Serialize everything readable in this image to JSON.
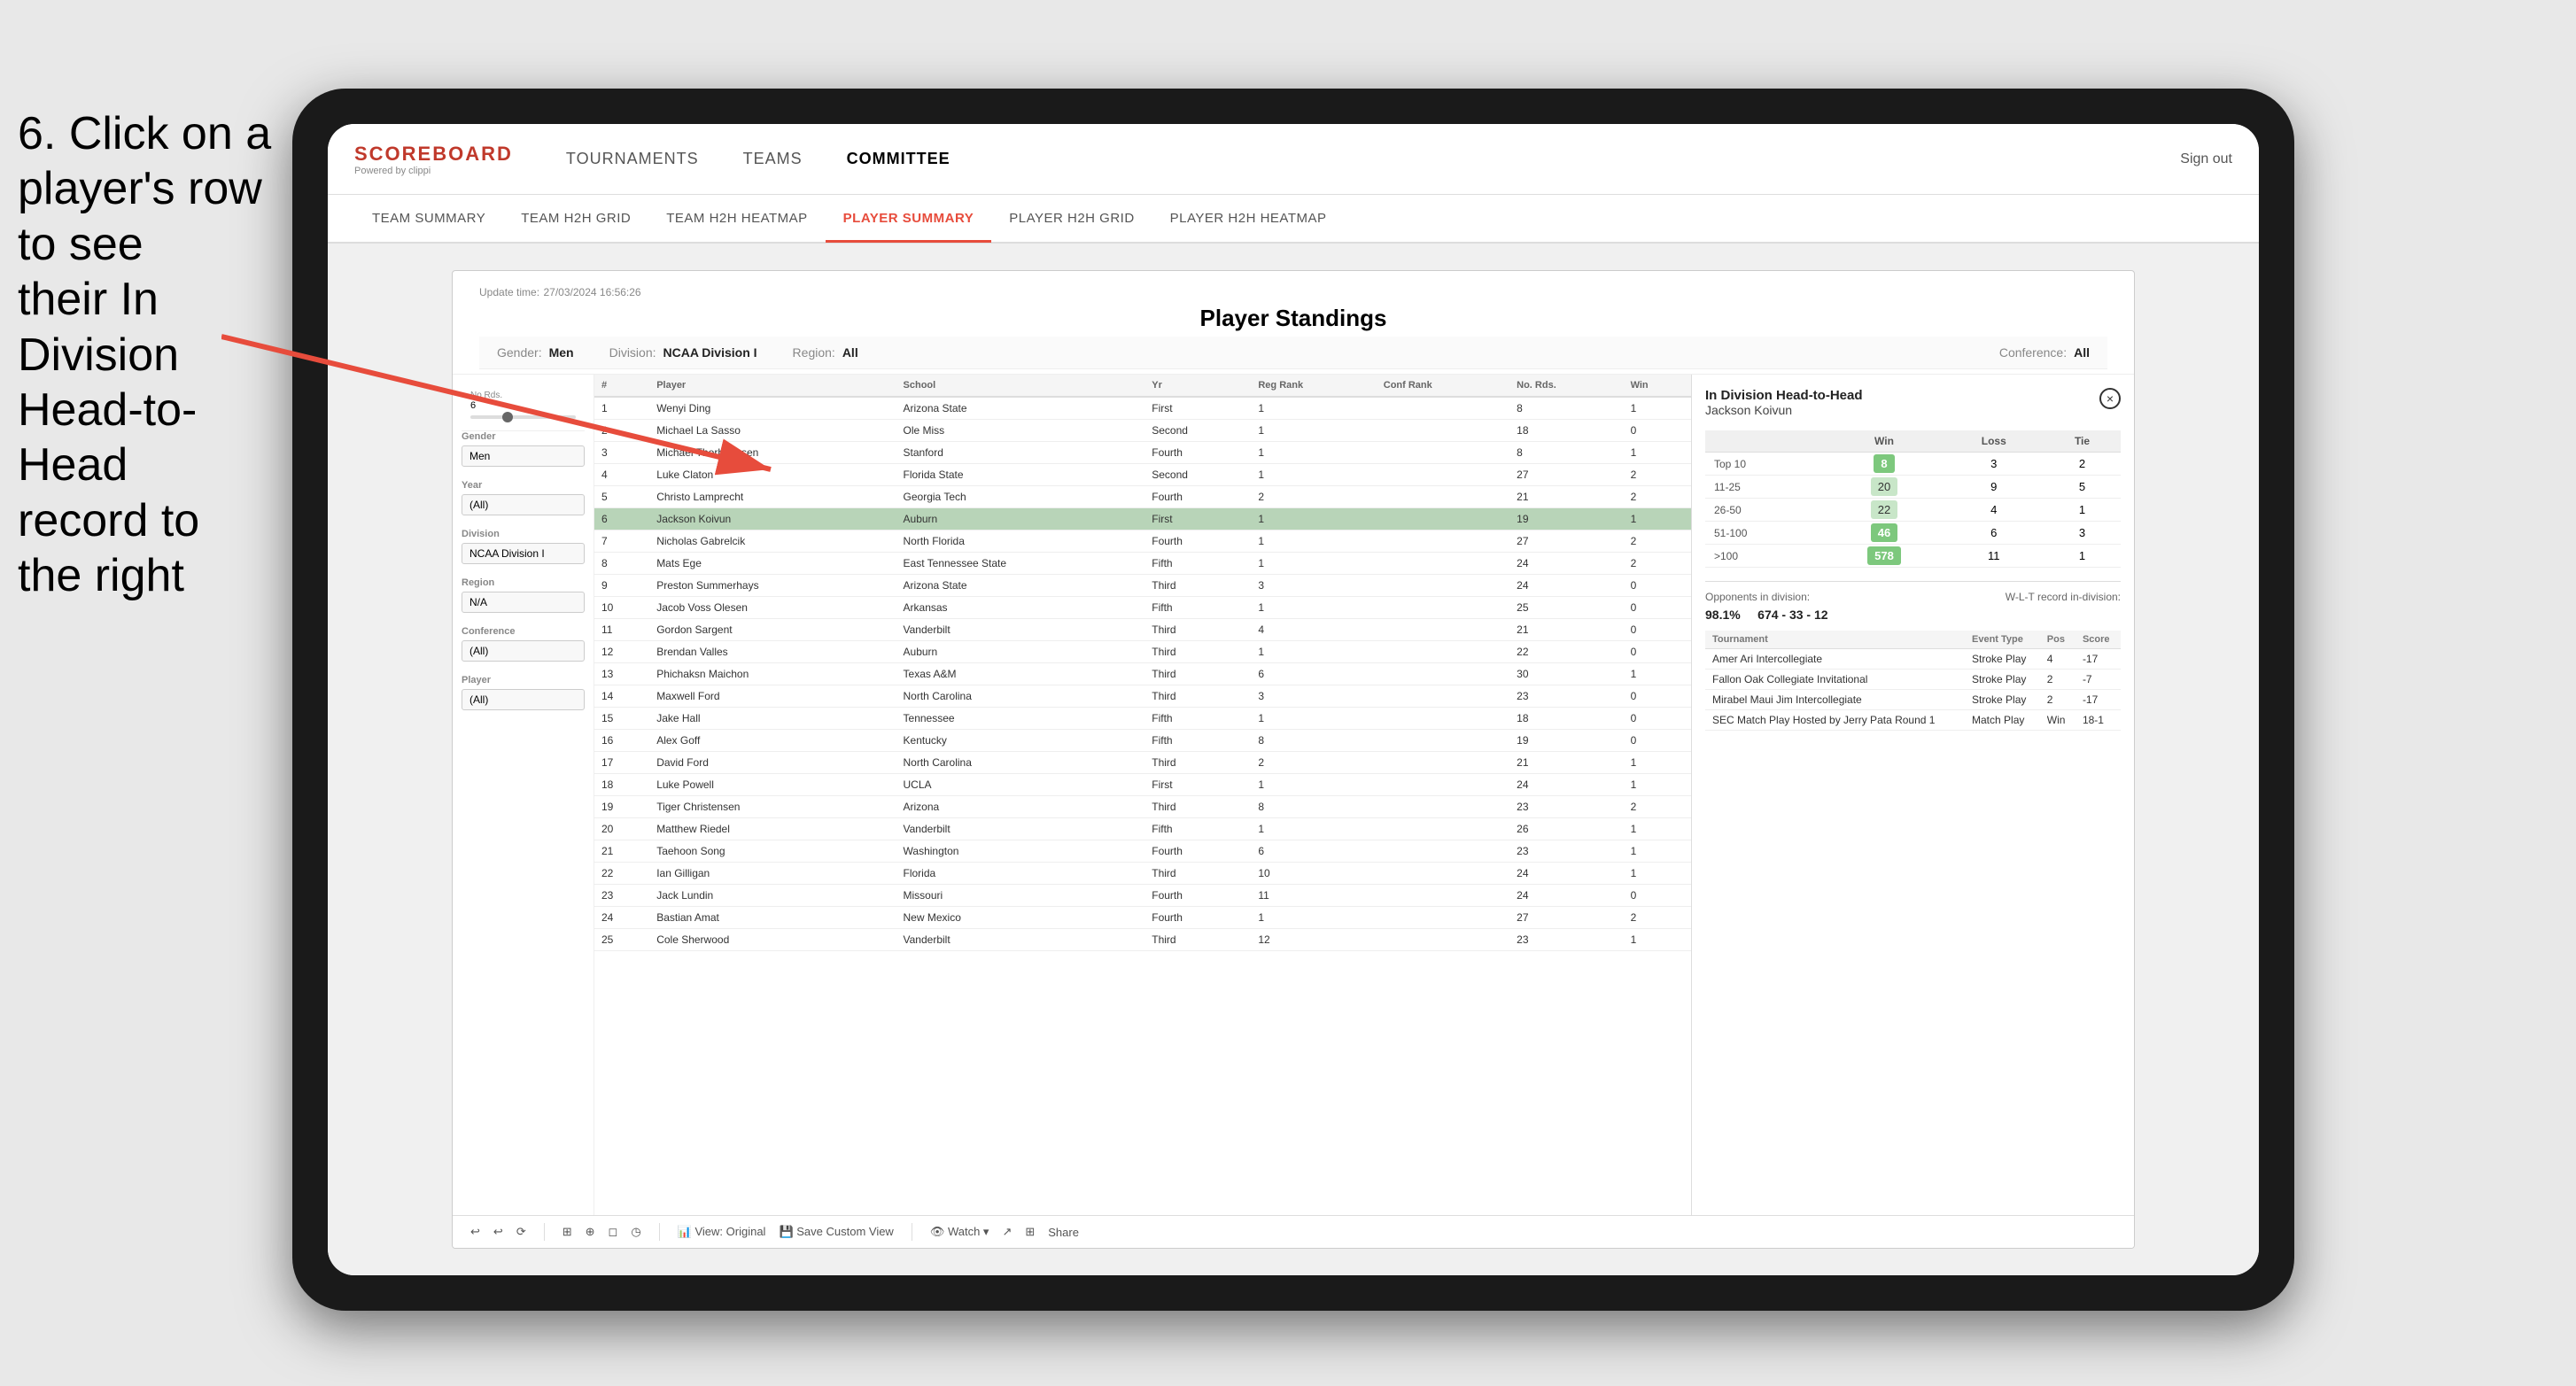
{
  "instruction": {
    "line1": "6. Click on a",
    "line2": "player's row to see",
    "line3": "their In Division",
    "line4": "Head-to-Head",
    "line5": "record to the right"
  },
  "nav": {
    "logo": "SCOREBOARD",
    "logo_sub": "Powered by clippi",
    "items": [
      "TOURNAMENTS",
      "TEAMS",
      "COMMITTEE"
    ],
    "sign_in": "Sign out"
  },
  "sub_nav": {
    "items": [
      "TEAM SUMMARY",
      "TEAM H2H GRID",
      "TEAM H2H HEATMAP",
      "PLAYER SUMMARY",
      "PLAYER H2H GRID",
      "PLAYER H2H HEATMAP"
    ],
    "active": "PLAYER SUMMARY"
  },
  "panel": {
    "update_label": "Update time:",
    "update_time": "27/03/2024 16:56:26",
    "title": "Player Standings",
    "filters": [
      {
        "label": "Gender:",
        "value": "Men"
      },
      {
        "label": "Division:",
        "value": "NCAA Division I"
      },
      {
        "label": "Region:",
        "value": "All"
      },
      {
        "label": "Conference:",
        "value": "All"
      }
    ]
  },
  "sidebar": {
    "no_rds_label": "No Rds.",
    "no_rds_values": "6",
    "gender_label": "Gender",
    "gender_value": "Men",
    "year_label": "Year",
    "year_value": "(All)",
    "division_label": "Division",
    "division_value": "NCAA Division I",
    "region_label": "Region",
    "region_value": "N/A",
    "conference_label": "Conference",
    "conference_value": "(All)",
    "player_label": "Player",
    "player_value": "(All)"
  },
  "table": {
    "headers": [
      "#",
      "Player",
      "School",
      "Yr",
      "Reg Rank",
      "Conf Rank",
      "No. Rds.",
      "Win"
    ],
    "rows": [
      {
        "num": 1,
        "player": "Wenyi Ding",
        "school": "Arizona State",
        "yr": "First",
        "reg": 1,
        "conf": "",
        "rds": 8,
        "win": 1,
        "selected": false
      },
      {
        "num": 2,
        "player": "Michael La Sasso",
        "school": "Ole Miss",
        "yr": "Second",
        "reg": 1,
        "conf": "",
        "rds": 18,
        "win": 0,
        "selected": false
      },
      {
        "num": 3,
        "player": "Michael Thorbjornsen",
        "school": "Stanford",
        "yr": "Fourth",
        "reg": 1,
        "conf": "",
        "rds": 8,
        "win": 1,
        "selected": false
      },
      {
        "num": 4,
        "player": "Luke Claton",
        "school": "Florida State",
        "yr": "Second",
        "reg": 1,
        "conf": "",
        "rds": 27,
        "win": 2,
        "selected": false
      },
      {
        "num": 5,
        "player": "Christo Lamprecht",
        "school": "Georgia Tech",
        "yr": "Fourth",
        "reg": 2,
        "conf": "",
        "rds": 21,
        "win": 2,
        "selected": false
      },
      {
        "num": 6,
        "player": "Jackson Koivun",
        "school": "Auburn",
        "yr": "First",
        "reg": 1,
        "conf": "",
        "rds": 19,
        "win": 1,
        "selected": true
      },
      {
        "num": 7,
        "player": "Nicholas Gabrelcik",
        "school": "North Florida",
        "yr": "Fourth",
        "reg": 1,
        "conf": "",
        "rds": 27,
        "win": 2,
        "selected": false
      },
      {
        "num": 8,
        "player": "Mats Ege",
        "school": "East Tennessee State",
        "yr": "Fifth",
        "reg": 1,
        "conf": "",
        "rds": 24,
        "win": 2,
        "selected": false
      },
      {
        "num": 9,
        "player": "Preston Summerhays",
        "school": "Arizona State",
        "yr": "Third",
        "reg": 3,
        "conf": "",
        "rds": 24,
        "win": 0,
        "selected": false
      },
      {
        "num": 10,
        "player": "Jacob Voss Olesen",
        "school": "Arkansas",
        "yr": "Fifth",
        "reg": 1,
        "conf": "",
        "rds": 25,
        "win": 0,
        "selected": false
      },
      {
        "num": 11,
        "player": "Gordon Sargent",
        "school": "Vanderbilt",
        "yr": "Third",
        "reg": 4,
        "conf": "",
        "rds": 21,
        "win": 0,
        "selected": false
      },
      {
        "num": 12,
        "player": "Brendan Valles",
        "school": "Auburn",
        "yr": "Third",
        "reg": 1,
        "conf": "",
        "rds": 22,
        "win": 0,
        "selected": false
      },
      {
        "num": 13,
        "player": "Phichaksn Maichon",
        "school": "Texas A&M",
        "yr": "Third",
        "reg": 6,
        "conf": "",
        "rds": 30,
        "win": 1,
        "selected": false
      },
      {
        "num": 14,
        "player": "Maxwell Ford",
        "school": "North Carolina",
        "yr": "Third",
        "reg": 3,
        "conf": "",
        "rds": 23,
        "win": 0,
        "selected": false
      },
      {
        "num": 15,
        "player": "Jake Hall",
        "school": "Tennessee",
        "yr": "Fifth",
        "reg": 1,
        "conf": "",
        "rds": 18,
        "win": 0,
        "selected": false
      },
      {
        "num": 16,
        "player": "Alex Goff",
        "school": "Kentucky",
        "yr": "Fifth",
        "reg": 8,
        "conf": "",
        "rds": 19,
        "win": 0,
        "selected": false
      },
      {
        "num": 17,
        "player": "David Ford",
        "school": "North Carolina",
        "yr": "Third",
        "reg": 2,
        "conf": "",
        "rds": 21,
        "win": 1,
        "selected": false
      },
      {
        "num": 18,
        "player": "Luke Powell",
        "school": "UCLA",
        "yr": "First",
        "reg": 1,
        "conf": "",
        "rds": 24,
        "win": 1,
        "selected": false
      },
      {
        "num": 19,
        "player": "Tiger Christensen",
        "school": "Arizona",
        "yr": "Third",
        "reg": 8,
        "conf": "",
        "rds": 23,
        "win": 2,
        "selected": false
      },
      {
        "num": 20,
        "player": "Matthew Riedel",
        "school": "Vanderbilt",
        "yr": "Fifth",
        "reg": 1,
        "conf": "",
        "rds": 26,
        "win": 1,
        "selected": false
      },
      {
        "num": 21,
        "player": "Taehoon Song",
        "school": "Washington",
        "yr": "Fourth",
        "reg": 6,
        "conf": "",
        "rds": 23,
        "win": 1,
        "selected": false
      },
      {
        "num": 22,
        "player": "Ian Gilligan",
        "school": "Florida",
        "yr": "Third",
        "reg": 10,
        "conf": "",
        "rds": 24,
        "win": 1,
        "selected": false
      },
      {
        "num": 23,
        "player": "Jack Lundin",
        "school": "Missouri",
        "yr": "Fourth",
        "reg": 11,
        "conf": "",
        "rds": 24,
        "win": 0,
        "selected": false
      },
      {
        "num": 24,
        "player": "Bastian Amat",
        "school": "New Mexico",
        "yr": "Fourth",
        "reg": 1,
        "conf": "",
        "rds": 27,
        "win": 2,
        "selected": false
      },
      {
        "num": 25,
        "player": "Cole Sherwood",
        "school": "Vanderbilt",
        "yr": "Third",
        "reg": 12,
        "conf": "",
        "rds": 23,
        "win": 1,
        "selected": false
      }
    ]
  },
  "h2h": {
    "title": "In Division Head-to-Head",
    "player": "Jackson Koivun",
    "close_label": "×",
    "table_headers": [
      "",
      "Win",
      "Loss",
      "Tie"
    ],
    "rows": [
      {
        "range": "Top 10",
        "win": 8,
        "loss": 3,
        "tie": 2,
        "win_shade": "dark"
      },
      {
        "range": "11-25",
        "win": 20,
        "loss": 9,
        "tie": 5,
        "win_shade": "medium"
      },
      {
        "range": "26-50",
        "win": 22,
        "loss": 4,
        "tie": 1,
        "win_shade": "medium"
      },
      {
        "range": "51-100",
        "win": 46,
        "loss": 6,
        "tie": 3,
        "win_shade": "dark"
      },
      {
        "range": ">100",
        "win": 578,
        "loss": 11,
        "tie": 1,
        "win_shade": "dark"
      }
    ],
    "opponents_label": "Opponents in division:",
    "wlt_label": "W-L-T record in-division:",
    "opponents_pct": "98.1%",
    "record": "674 - 33 - 12",
    "tournament_headers": [
      "Tournament",
      "Event Type",
      "Pos",
      "Score"
    ],
    "tournaments": [
      {
        "name": "Amer Ari Intercollegiate",
        "type": "Stroke Play",
        "pos": 4,
        "score": "-17"
      },
      {
        "name": "Fallon Oak Collegiate Invitational",
        "type": "Stroke Play",
        "pos": 2,
        "score": "-7"
      },
      {
        "name": "Mirabel Maui Jim Intercollegiate",
        "type": "Stroke Play",
        "pos": 2,
        "score": "-17"
      },
      {
        "name": "SEC Match Play Hosted by Jerry Pate Round 1",
        "type": "Match Play",
        "pos": "Win",
        "score": "18-1"
      }
    ]
  },
  "toolbar": {
    "buttons": [
      "↩",
      "↩",
      "⟳",
      "⊞",
      "⊕",
      "◻",
      "◷",
      "View: Original",
      "Save Custom View",
      "👁 Watch ▾",
      "↗",
      "⊞",
      "Share"
    ]
  }
}
